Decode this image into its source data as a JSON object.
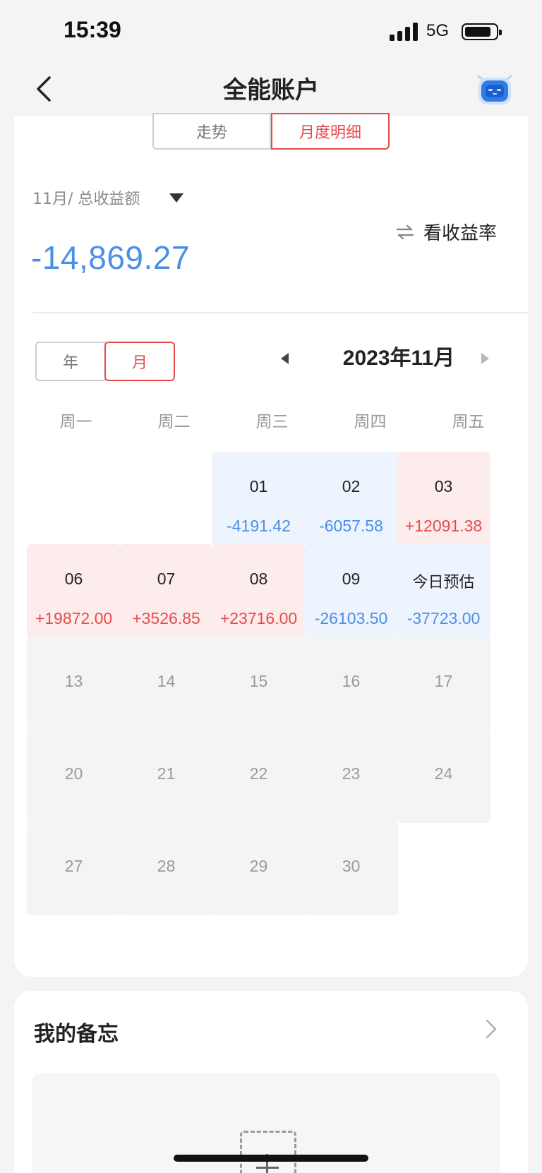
{
  "status_bar": {
    "time": "15:39",
    "network": "5G"
  },
  "nav": {
    "title": "全能账户",
    "back_icon": "chevron-left-icon",
    "assistant_icon": "robot-icon"
  },
  "tabs": [
    {
      "label": "走势",
      "active": false
    },
    {
      "label": "月度明细",
      "active": true
    }
  ],
  "summary": {
    "metric_label": "11月/ 总收益额",
    "switch_label": "看收益率",
    "total": "-14,869.27",
    "total_color": "#4a8fe6"
  },
  "period_toggle": {
    "year": "年",
    "month": "月",
    "active": "月"
  },
  "calendar": {
    "title": "2023年11月",
    "weekdays": [
      "周一",
      "周二",
      "周三",
      "周四",
      "周五"
    ],
    "cells": [
      {
        "col": 2,
        "row": 0,
        "day": "01",
        "value": "-4191.42",
        "tone": "blue"
      },
      {
        "col": 3,
        "row": 0,
        "day": "02",
        "value": "-6057.58",
        "tone": "blue"
      },
      {
        "col": 4,
        "row": 0,
        "day": "03",
        "value": "+12091.38",
        "tone": "red"
      },
      {
        "col": 0,
        "row": 1,
        "day": "06",
        "value": "+19872.00",
        "tone": "red"
      },
      {
        "col": 1,
        "row": 1,
        "day": "07",
        "value": "+3526.85",
        "tone": "red"
      },
      {
        "col": 2,
        "row": 1,
        "day": "08",
        "value": "+23716.00",
        "tone": "red"
      },
      {
        "col": 3,
        "row": 1,
        "day": "09",
        "value": "-26103.50",
        "tone": "blue"
      },
      {
        "col": 4,
        "row": 1,
        "day": "今日预估",
        "value": "-37723.00",
        "tone": "blue",
        "estimate": true
      },
      {
        "col": 0,
        "row": 2,
        "day": "13",
        "tone": "grey"
      },
      {
        "col": 1,
        "row": 2,
        "day": "14",
        "tone": "grey"
      },
      {
        "col": 2,
        "row": 2,
        "day": "15",
        "tone": "grey"
      },
      {
        "col": 3,
        "row": 2,
        "day": "16",
        "tone": "grey"
      },
      {
        "col": 4,
        "row": 2,
        "day": "17",
        "tone": "grey"
      },
      {
        "col": 0,
        "row": 3,
        "day": "20",
        "tone": "grey"
      },
      {
        "col": 1,
        "row": 3,
        "day": "21",
        "tone": "grey"
      },
      {
        "col": 2,
        "row": 3,
        "day": "22",
        "tone": "grey"
      },
      {
        "col": 3,
        "row": 3,
        "day": "23",
        "tone": "grey"
      },
      {
        "col": 4,
        "row": 3,
        "day": "24",
        "tone": "grey"
      },
      {
        "col": 0,
        "row": 4,
        "day": "27",
        "tone": "grey"
      },
      {
        "col": 1,
        "row": 4,
        "day": "28",
        "tone": "grey"
      },
      {
        "col": 2,
        "row": 4,
        "day": "29",
        "tone": "grey"
      },
      {
        "col": 3,
        "row": 4,
        "day": "30",
        "tone": "grey"
      }
    ],
    "colors": {
      "loss": "#4a8fe6",
      "gain": "#e84a4a"
    }
  },
  "memo": {
    "title": "我的备忘",
    "add_icon": "add-icon"
  }
}
